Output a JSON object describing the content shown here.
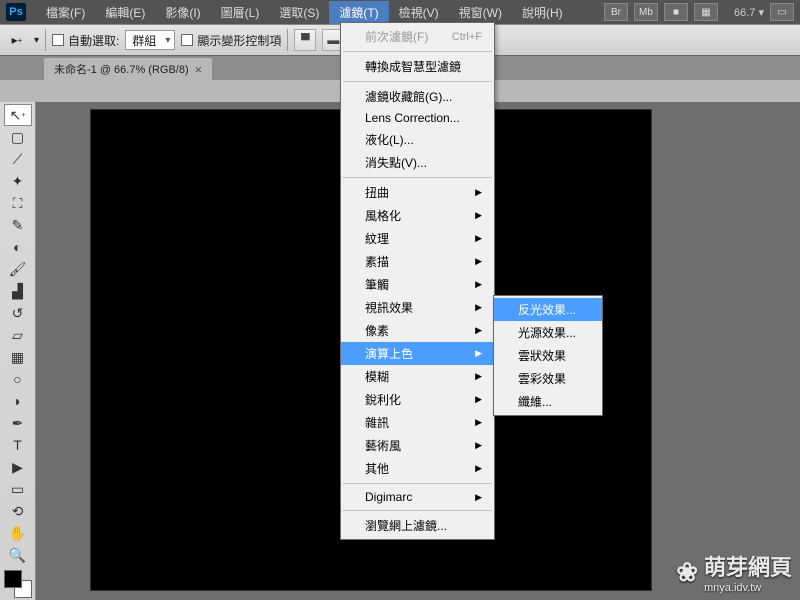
{
  "app": {
    "logo": "Ps"
  },
  "titlebar": {
    "buttons": [
      "Br",
      "Mb",
      "■",
      "▦"
    ],
    "zoom": "66.7",
    "arrow": "▾"
  },
  "menubar": {
    "items": [
      {
        "label": "檔案(F)"
      },
      {
        "label": "編輯(E)"
      },
      {
        "label": "影像(I)"
      },
      {
        "label": "圖層(L)"
      },
      {
        "label": "選取(S)"
      },
      {
        "label": "濾鏡(T)",
        "active": true
      },
      {
        "label": "檢視(V)"
      },
      {
        "label": "視窗(W)"
      },
      {
        "label": "說明(H)"
      }
    ]
  },
  "optbar": {
    "auto_select_label": "自動選取:",
    "select_value": "群組",
    "show_transform_label": "顯示變形控制項"
  },
  "doctab": {
    "title": "未命名-1 @ 66.7% (RGB/8)",
    "close": "×"
  },
  "filter_menu": {
    "primary": [
      {
        "label": "前次濾鏡(F)",
        "shortcut": "Ctrl+F",
        "disabled": true
      }
    ],
    "group1": [
      {
        "label": "轉換成智慧型濾鏡"
      }
    ],
    "group2": [
      {
        "label": "濾鏡收藏館(G)..."
      },
      {
        "label": "Lens Correction..."
      },
      {
        "label": "液化(L)..."
      },
      {
        "label": "消失點(V)..."
      }
    ],
    "group3": [
      {
        "label": "扭曲",
        "arrow": true
      },
      {
        "label": "風格化",
        "arrow": true
      },
      {
        "label": "紋理",
        "arrow": true
      },
      {
        "label": "素描",
        "arrow": true
      },
      {
        "label": "筆觸",
        "arrow": true
      },
      {
        "label": "視訊效果",
        "arrow": true
      },
      {
        "label": "像素",
        "arrow": true
      },
      {
        "label": "演算上色",
        "arrow": true,
        "hov": true
      },
      {
        "label": "模糊",
        "arrow": true
      },
      {
        "label": "銳利化",
        "arrow": true
      },
      {
        "label": "雜訊",
        "arrow": true
      },
      {
        "label": "藝術風",
        "arrow": true
      },
      {
        "label": "其他",
        "arrow": true
      }
    ],
    "group4": [
      {
        "label": "Digimarc",
        "arrow": true
      }
    ],
    "group5": [
      {
        "label": "瀏覽網上濾鏡..."
      }
    ]
  },
  "submenu": {
    "items": [
      {
        "label": "反光效果...",
        "hov": true
      },
      {
        "label": "光源效果..."
      },
      {
        "label": "雲狀效果"
      },
      {
        "label": "雲彩效果"
      },
      {
        "label": "纖維..."
      }
    ]
  },
  "watermark": {
    "text": "萌芽網頁",
    "url": "mnya.idv.tw"
  }
}
